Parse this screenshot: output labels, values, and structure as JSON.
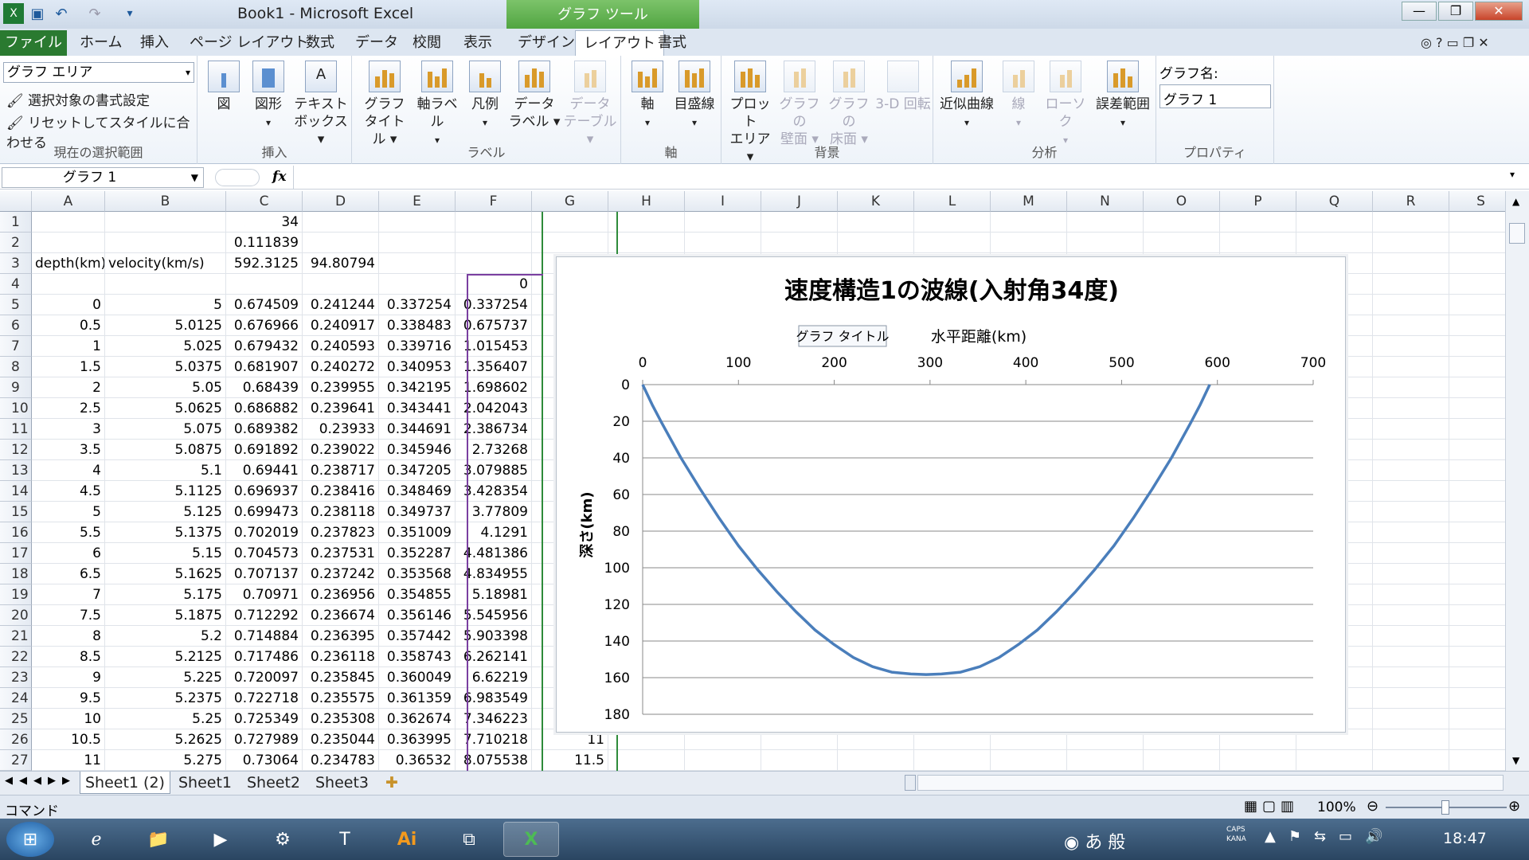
{
  "window": {
    "title": "Book1  -  Microsoft Excel",
    "tools_header": "グラフ ツール",
    "controls": {
      "minimize": "—",
      "restore": "❐",
      "close": "✕"
    }
  },
  "tabs": {
    "file": "ファイル",
    "home": "ホーム",
    "insert": "挿入",
    "page_layout": "ページ レイアウト",
    "formulas": "数式",
    "data": "データ",
    "review": "校閲",
    "view": "表示",
    "design": "デザイン",
    "layout": "レイアウト",
    "format": "書式"
  },
  "ribbon": {
    "current_selection": {
      "selected": "グラフ エリア",
      "format_selection": "選択対象の書式設定",
      "reset_style": "リセットしてスタイルに合わせる",
      "label": "現在の選択範囲"
    },
    "insert": {
      "picture": "図",
      "shapes": "図形",
      "textbox_1": "テキスト",
      "textbox_2": "ボックス",
      "label": "挿入"
    },
    "labels": {
      "chart_title_1": "グラフ",
      "chart_title_2": "タイトル",
      "axis_titles": "軸ラベル",
      "legend": "凡例",
      "data_labels_1": "データ",
      "data_labels_2": "ラベル",
      "data_table_1": "データ",
      "data_table_2": "テーブル",
      "label": "ラベル"
    },
    "axes": {
      "axes": "軸",
      "gridlines": "目盛線",
      "label": "軸"
    },
    "background": {
      "plot_area_1": "プロット",
      "plot_area_2": "エリア",
      "wall_1": "グラフの",
      "wall_2": "壁面",
      "floor_1": "グラフの",
      "floor_2": "床面",
      "rotation": "3-D 回転",
      "label": "背景"
    },
    "analysis": {
      "trendline": "近似曲線",
      "lines": "線",
      "updown": "ローソク",
      "error_bars": "誤差範囲",
      "label": "分析"
    },
    "properties": {
      "chart_name_label": "グラフ名:",
      "chart_name": "グラフ 1",
      "label": "プロパティ"
    }
  },
  "formula_bar": {
    "name_box": "グラフ 1",
    "fx": "fx",
    "value": ""
  },
  "columns": [
    "A",
    "B",
    "C",
    "D",
    "E",
    "F",
    "G",
    "H",
    "I",
    "J",
    "K",
    "L",
    "M",
    "N",
    "O",
    "P",
    "Q",
    "R",
    "S"
  ],
  "rows": [
    {
      "n": "1",
      "a": "",
      "b": "",
      "c": "34",
      "d": "",
      "e": "",
      "f": "",
      "g": ""
    },
    {
      "n": "2",
      "a": "",
      "b": "",
      "c": "0.111839",
      "d": "",
      "e": "",
      "f": "",
      "g": ""
    },
    {
      "n": "3",
      "a": "depth(km)",
      "b": "velocity(km/s)",
      "c": "592.3125",
      "d": "94.80794",
      "e": "",
      "f": "",
      "g": ""
    },
    {
      "n": "4",
      "a": "",
      "b": "",
      "c": "",
      "d": "",
      "e": "",
      "f": "0",
      "g": ""
    },
    {
      "n": "5",
      "a": "0",
      "b": "5",
      "c": "0.674509",
      "d": "0.241244",
      "e": "0.337254",
      "f": "0.337254",
      "g": ""
    },
    {
      "n": "6",
      "a": "0.5",
      "b": "5.0125",
      "c": "0.676966",
      "d": "0.240917",
      "e": "0.338483",
      "f": "0.675737",
      "g": ""
    },
    {
      "n": "7",
      "a": "1",
      "b": "5.025",
      "c": "0.679432",
      "d": "0.240593",
      "e": "0.339716",
      "f": "1.015453",
      "g": ""
    },
    {
      "n": "8",
      "a": "1.5",
      "b": "5.0375",
      "c": "0.681907",
      "d": "0.240272",
      "e": "0.340953",
      "f": "1.356407",
      "g": ""
    },
    {
      "n": "9",
      "a": "2",
      "b": "5.05",
      "c": "0.68439",
      "d": "0.239955",
      "e": "0.342195",
      "f": "1.698602",
      "g": ""
    },
    {
      "n": "10",
      "a": "2.5",
      "b": "5.0625",
      "c": "0.686882",
      "d": "0.239641",
      "e": "0.343441",
      "f": "2.042043",
      "g": ""
    },
    {
      "n": "11",
      "a": "3",
      "b": "5.075",
      "c": "0.689382",
      "d": "0.23933",
      "e": "0.344691",
      "f": "2.386734",
      "g": ""
    },
    {
      "n": "12",
      "a": "3.5",
      "b": "5.0875",
      "c": "0.691892",
      "d": "0.239022",
      "e": "0.345946",
      "f": "2.73268",
      "g": ""
    },
    {
      "n": "13",
      "a": "4",
      "b": "5.1",
      "c": "0.69441",
      "d": "0.238717",
      "e": "0.347205",
      "f": "3.079885",
      "g": ""
    },
    {
      "n": "14",
      "a": "4.5",
      "b": "5.1125",
      "c": "0.696937",
      "d": "0.238416",
      "e": "0.348469",
      "f": "3.428354",
      "g": ""
    },
    {
      "n": "15",
      "a": "5",
      "b": "5.125",
      "c": "0.699473",
      "d": "0.238118",
      "e": "0.349737",
      "f": "3.77809",
      "g": ""
    },
    {
      "n": "16",
      "a": "5.5",
      "b": "5.1375",
      "c": "0.702019",
      "d": "0.237823",
      "e": "0.351009",
      "f": "4.1291",
      "g": ""
    },
    {
      "n": "17",
      "a": "6",
      "b": "5.15",
      "c": "0.704573",
      "d": "0.237531",
      "e": "0.352287",
      "f": "4.481386",
      "g": ""
    },
    {
      "n": "18",
      "a": "6.5",
      "b": "5.1625",
      "c": "0.707137",
      "d": "0.237242",
      "e": "0.353568",
      "f": "4.834955",
      "g": ""
    },
    {
      "n": "19",
      "a": "7",
      "b": "5.175",
      "c": "0.70971",
      "d": "0.236956",
      "e": "0.354855",
      "f": "5.18981",
      "g": ""
    },
    {
      "n": "20",
      "a": "7.5",
      "b": "5.1875",
      "c": "0.712292",
      "d": "0.236674",
      "e": "0.356146",
      "f": "5.545956",
      "g": ""
    },
    {
      "n": "21",
      "a": "8",
      "b": "5.2",
      "c": "0.714884",
      "d": "0.236395",
      "e": "0.357442",
      "f": "5.903398",
      "g": ""
    },
    {
      "n": "22",
      "a": "8.5",
      "b": "5.2125",
      "c": "0.717486",
      "d": "0.236118",
      "e": "0.358743",
      "f": "6.262141",
      "g": ""
    },
    {
      "n": "23",
      "a": "9",
      "b": "5.225",
      "c": "0.720097",
      "d": "0.235845",
      "e": "0.360049",
      "f": "6.62219",
      "g": ""
    },
    {
      "n": "24",
      "a": "9.5",
      "b": "5.2375",
      "c": "0.722718",
      "d": "0.235575",
      "e": "0.361359",
      "f": "6.983549",
      "g": ""
    },
    {
      "n": "25",
      "a": "10",
      "b": "5.25",
      "c": "0.725349",
      "d": "0.235308",
      "e": "0.362674",
      "f": "7.346223",
      "g": ""
    },
    {
      "n": "26",
      "a": "10.5",
      "b": "5.2625",
      "c": "0.727989",
      "d": "0.235044",
      "e": "0.363995",
      "f": "7.710218",
      "g": "11"
    },
    {
      "n": "27",
      "a": "11",
      "b": "5.275",
      "c": "0.73064",
      "d": "0.234783",
      "e": "0.36532",
      "f": "8.075538",
      "g": "11.5"
    }
  ],
  "chart_data": {
    "type": "scatter",
    "title": "速度構造1の波線(入射角34度)",
    "tooltip": "グラフ タイトル",
    "xlabel": "水平距離(km)",
    "ylabel": "深さ(km)",
    "xlim": [
      0,
      700
    ],
    "ylim": [
      0,
      180
    ],
    "y_reversed": true,
    "x_axis_position": "top",
    "x_ticks": [
      "0",
      "100",
      "200",
      "300",
      "400",
      "500",
      "600",
      "700"
    ],
    "y_ticks": [
      "0",
      "20",
      "40",
      "60",
      "80",
      "100",
      "120",
      "140",
      "160",
      "180"
    ],
    "grid": "horizontal",
    "line_color": "#4a7ebb",
    "series": [
      {
        "x": [
          0,
          10,
          20,
          40,
          60,
          80,
          100,
          120,
          140,
          160,
          180,
          200,
          220,
          240,
          260,
          280,
          296,
          312,
          332,
          352,
          372,
          392,
          412,
          432,
          452,
          472,
          492,
          512,
          532,
          552,
          572,
          582,
          592
        ],
        "y": [
          0,
          11,
          21,
          40,
          57,
          73,
          88,
          101,
          113,
          124,
          134,
          142,
          149,
          154,
          157,
          158,
          158.3,
          158,
          157,
          154,
          149,
          142,
          134,
          124,
          113,
          101,
          88,
          73,
          57,
          40,
          21,
          11,
          0
        ]
      }
    ]
  },
  "sheet_tabs": [
    "Sheet1 (2)",
    "Sheet1",
    "Sheet2",
    "Sheet3"
  ],
  "status": {
    "mode": "コマンド",
    "zoom": "100%"
  },
  "taskbar": {
    "ime_a": "あ",
    "ime_mode": "般",
    "caps": "CAPS",
    "kana": "KANA",
    "clock": "18:47"
  }
}
